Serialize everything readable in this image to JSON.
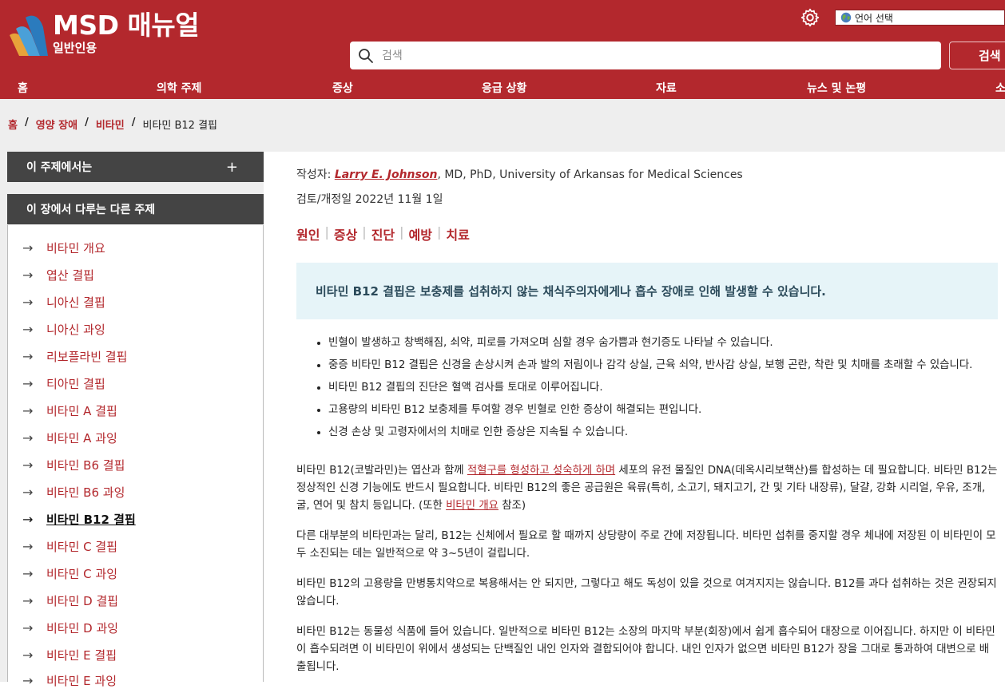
{
  "brand": {
    "title": "MSD 매뉴얼",
    "subtitle": "일반인용",
    "color_primary": "#b3282d"
  },
  "header": {
    "language_select": "언어 선택",
    "search_placeholder": "검색",
    "search_button": "검색",
    "settings_icon": "gear-icon"
  },
  "nav": {
    "items": [
      "홈",
      "의학 주제",
      "증상",
      "응급 상황",
      "자료",
      "뉴스 및 논평",
      "소"
    ]
  },
  "breadcrumb": [
    "홈",
    "영양 장애",
    "비타민",
    "비타민 B12 결핍"
  ],
  "sidebar": {
    "in_this_topic": "이 주제에서는",
    "in_this_topic_icon": "+",
    "other_topics_heading": "이 장에서 다루는 다른 주제",
    "topics": [
      "비타민 개요",
      "엽산 결핍",
      "니아신 결핍",
      "니아신 과잉",
      "리보플라빈 결핍",
      "티아민 결핍",
      "비타민 A 결핍",
      "비타민 A 과잉",
      "비타민 B6 결핍",
      "비타민 B6 과잉",
      "비타민 B12 결핍",
      "비타민 C 결핍",
      "비타민 C 과잉",
      "비타민 D 결핍",
      "비타민 D 과잉",
      "비타민 E 결핍",
      "비타민 E 과잉"
    ],
    "active_topic": "비타민 B12 결핍"
  },
  "article": {
    "author_prefix": "작성자: ",
    "author_name": "Larry E. Johnson",
    "author_suffix": ", MD, PhD, University of Arkansas for Medical Sciences",
    "reviewed": "검토/개정일 2022년 11월 1일",
    "jump_links": [
      "원인",
      "증상",
      "진단",
      "예방",
      "치료"
    ],
    "summary": "비타민 B12 결핍은 보충제를 섭취하지 않는 채식주의자에게나 흡수 장애로 인해 발생할 수 있습니다.",
    "bullets": [
      "빈혈이 발생하고 창백해짐, 쇠약, 피로를 가져오며 심할 경우 숨가쁨과 현기증도 나타날 수 있습니다.",
      "중증 비타민 B12 결핍은 신경을 손상시켜 손과 발의 저림이나 감각 상실, 근육 쇠약, 반사감 상실, 보행 곤란, 착란 및 치매를 초래할 수 있습니다.",
      "비타민 B12 결핍의 진단은 혈액 검사를 토대로 이루어집니다.",
      "고용량의 비타민 B12 보충제를 투여할 경우 빈혈로 인한 증상이 해결되는 편입니다.",
      "신경 손상 및 고령자에서의 치매로 인한 증상은 지속될 수 있습니다."
    ],
    "p1_a": "비타민 B12(코발라민)는 엽산과 함께 ",
    "p1_link": "적혈구를 형성하고 성숙하게 하며",
    "p1_b": " 세포의 유전 물질인 DNA(데옥시리보핵산)를 합성하는 데 필요합니다. 비타민 B12는 정상적인 신경 기능에도 반드시 필요합니다. 비타민 B12의 좋은 공급원은 육류(특히, 소고기, 돼지고기, 간 및 기타 내장류), 달걀, 강화 시리얼, 우유, 조개, 굴, 연어 및 참치 등입니다. (또한 ",
    "p1_link2": "비타민 개요",
    "p1_c": " 참조)",
    "p2": "다른 대부분의 비타민과는 달리, B12는 신체에서 필요로 할 때까지 상당량이 주로 간에 저장됩니다. 비타민 섭취를 중지할 경우 체내에 저장된 이 비타민이 모두 소진되는 데는 일반적으로 약 3~5년이 걸립니다.",
    "p3": "비타민 B12의 고용량을 만병통치약으로 복용해서는 안 되지만, 그렇다고 해도 독성이 있을 것으로 여겨지지는 않습니다. B12를 과다 섭취하는 것은 권장되지 않습니다.",
    "p4": "비타민 B12는 동물성 식품에 들어 있습니다. 일반적으로 비타민 B12는 소장의 마지막 부분(회장)에서 쉽게 흡수되어 대장으로 이어집니다. 하지만 이 비타민이 흡수되려면 이 비타민이 위에서 생성되는 단백질인 내인 인자와 결합되어야 합니다. 내인 인자가 없으면 비타민 B12가 장을 그대로 통과하여 대변으로 배출됩니다."
  }
}
